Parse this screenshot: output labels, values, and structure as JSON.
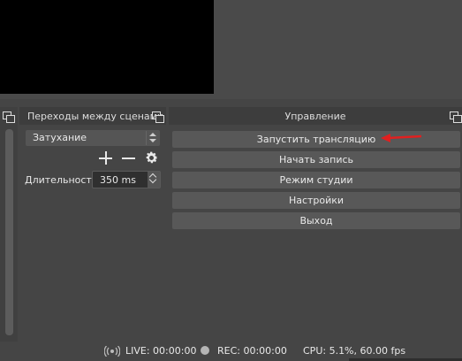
{
  "transitions_panel": {
    "title": "Переходы между сценами",
    "transition_type": "Затухание",
    "duration_label": "Длительность",
    "duration_value": "350 ms"
  },
  "controls_panel": {
    "title": "Управление",
    "buttons": {
      "start_streaming": "Запустить трансляцию",
      "start_recording": "Начать запись",
      "studio_mode": "Режим студии",
      "settings": "Настройки",
      "exit": "Выход"
    }
  },
  "status_bar": {
    "live": "LIVE: 00:00:00",
    "rec": "REC: 00:00:00",
    "cpu": "CPU: 5.1%, 60.00 fps"
  },
  "colors": {
    "background": "#454545",
    "button": "#585858",
    "annotation_arrow": "#e02020"
  },
  "icons": [
    "float-dock-icon",
    "plus-icon",
    "minus-icon",
    "gear-icon",
    "live-broadcast-icon",
    "rec-dot-icon",
    "annotation-arrow"
  ]
}
